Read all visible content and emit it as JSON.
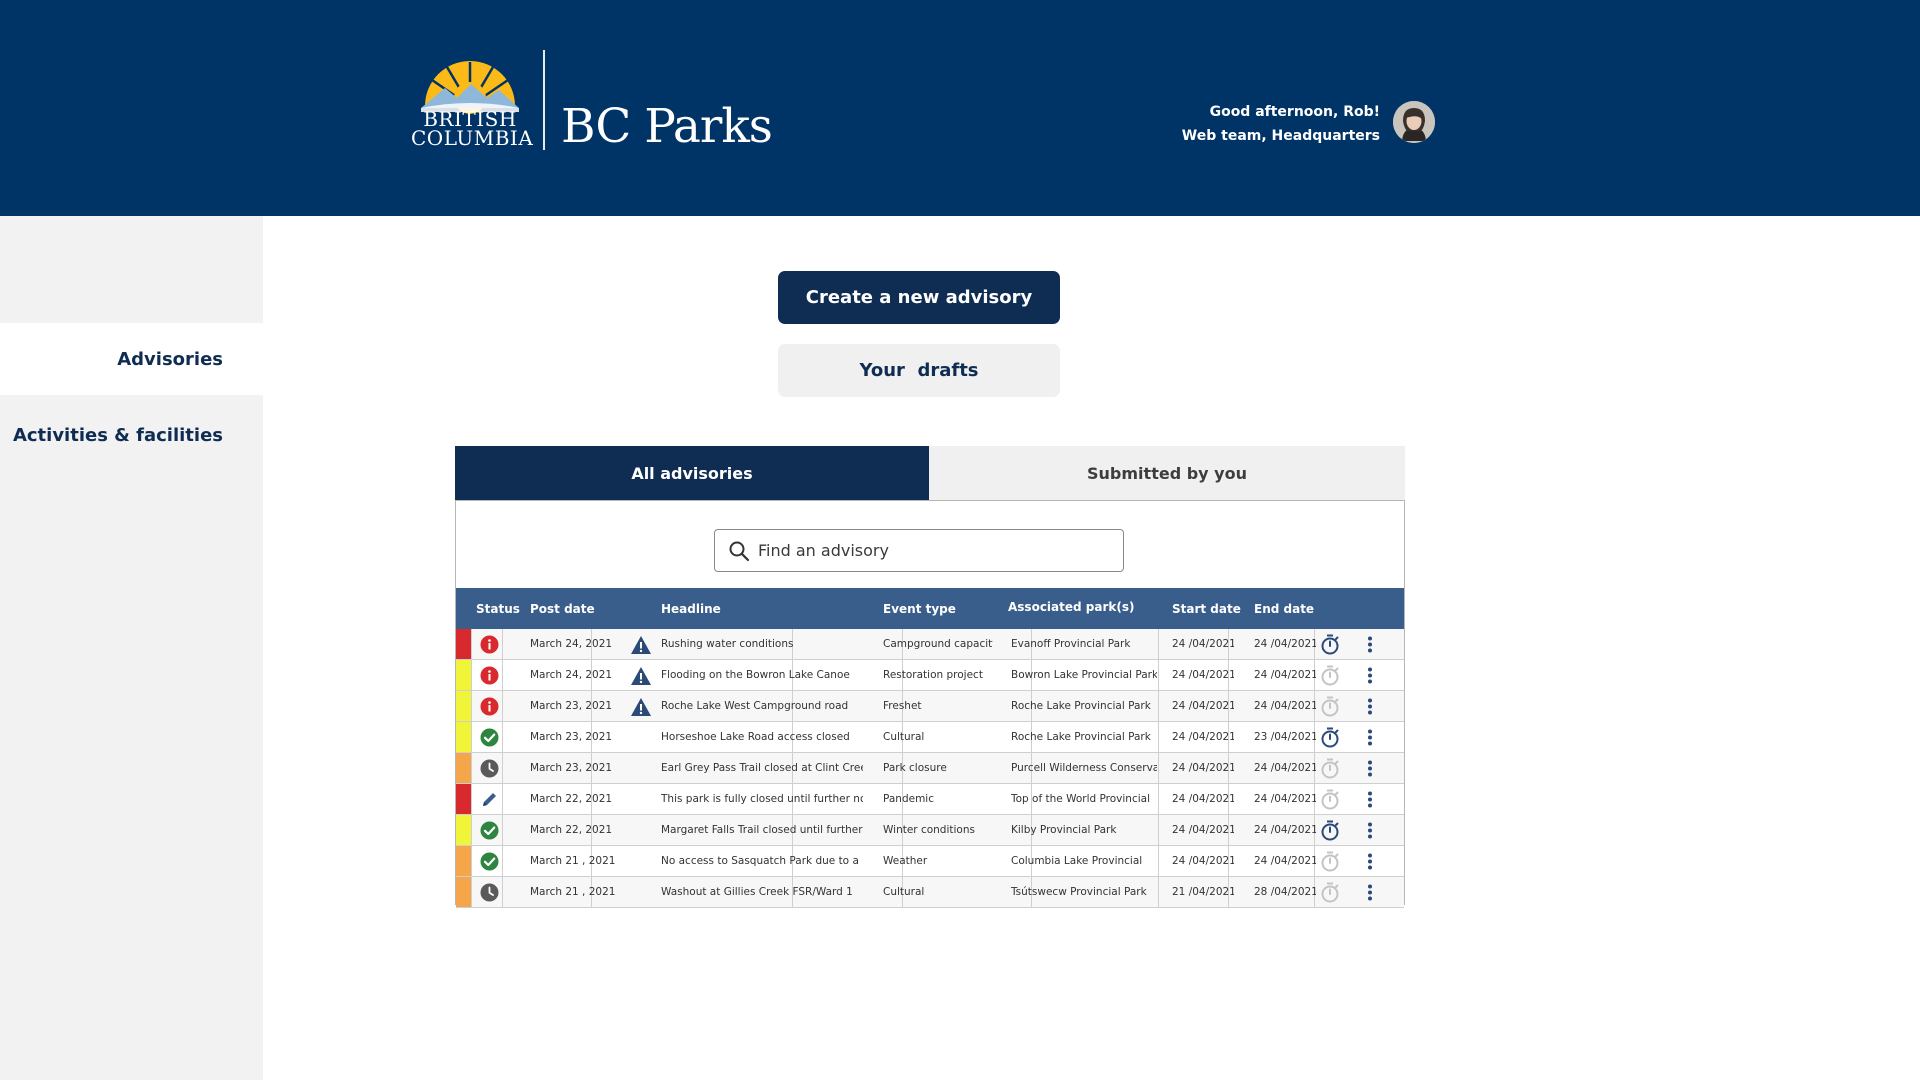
{
  "header": {
    "logo_left_lines": [
      "BRITISH",
      "COLUMBIA"
    ],
    "logo_right": "BC Parks",
    "greeting": "Good afternoon, Rob!",
    "team": "Web team, Headquarters"
  },
  "sidebar": {
    "items": [
      {
        "label": "Advisories",
        "active": true
      },
      {
        "label": "Activities & facilities",
        "active": false
      }
    ]
  },
  "actions": {
    "create_label": "Create a new advisory",
    "drafts_label": "Your  drafts"
  },
  "tabs": [
    {
      "label": "All advisories",
      "active": true
    },
    {
      "label": "Submitted by you",
      "active": false
    }
  ],
  "search": {
    "placeholder": "Find an advisory"
  },
  "table": {
    "columns": [
      "Status",
      "Post date",
      "Headline",
      "Event type",
      "Associated park(s)",
      "Start date",
      "End date"
    ],
    "rows": [
      {
        "urgency": "red",
        "status": "alert",
        "post_date": "March 24, 2021",
        "warning": true,
        "headline": "Rushing water conditions",
        "event_type": "Campground capacity",
        "park": "Evanoff Provincial Park",
        "start": "24 /04/2021",
        "end": "24 /04/2021",
        "timer": "active"
      },
      {
        "urgency": "yellow",
        "status": "alert",
        "post_date": "March 24, 2021",
        "warning": true,
        "headline": "Flooding on the Bowron Lake Canoe",
        "event_type": "Restoration project",
        "park": "Bowron Lake Provincial Park",
        "start": "24 /04/2021",
        "end": "24 /04/2021",
        "timer": "inactive"
      },
      {
        "urgency": "yellow",
        "status": "alert",
        "post_date": "March 23, 2021",
        "warning": true,
        "headline": "Roche Lake West Campground road",
        "event_type": "Freshet",
        "park": "Roche Lake Provincial Park",
        "start": "24 /04/2021",
        "end": "24 /04/2021",
        "timer": "inactive"
      },
      {
        "urgency": "yellow",
        "status": "published",
        "post_date": "March 23, 2021",
        "warning": false,
        "headline": "Horseshoe Lake Road access closed",
        "event_type": "Cultural",
        "park": "Roche Lake Provincial Park",
        "start": "24 /04/2021",
        "end": "23 /04/2021",
        "timer": "active"
      },
      {
        "urgency": "orange",
        "status": "scheduled",
        "post_date": "March 23, 2021",
        "warning": false,
        "headline": "Earl Grey Pass Trail closed at Clint Creek",
        "event_type": "Park closure",
        "park": "Purcell Wilderness Conserva",
        "start": "24 /04/2021",
        "end": "24 /04/2021",
        "timer": "inactive"
      },
      {
        "urgency": "red",
        "status": "draft",
        "post_date": "March 22, 2021",
        "warning": false,
        "headline": "This park is fully closed until further noti",
        "event_type": "Pandemic",
        "park": "Top of the World Provincial",
        "start": "24 /04/2021",
        "end": "24 /04/2021",
        "timer": "inactive"
      },
      {
        "urgency": "yellow",
        "status": "published",
        "post_date": "March 22, 2021",
        "warning": false,
        "headline": "Margaret Falls Trail closed until further",
        "event_type": "Winter conditions",
        "park": "Kilby Provincial Park",
        "start": "24 /04/2021",
        "end": "24 /04/2021",
        "timer": "active"
      },
      {
        "urgency": "orange",
        "status": "published",
        "post_date": "March 21 , 2021",
        "warning": false,
        "headline": "No access to Sasquatch Park due to a",
        "event_type": "Weather",
        "park": "Columbia Lake Provincial",
        "start": "24 /04/2021",
        "end": "24 /04/2021",
        "timer": "inactive"
      },
      {
        "urgency": "orange",
        "status": "scheduled",
        "post_date": "March 21 , 2021",
        "warning": false,
        "headline": "Washout at Gillies Creek FSR/Ward 1",
        "event_type": "Cultural",
        "park": "Tsútswecw Provincial Park",
        "start": "21 /04/2021",
        "end": "28 /04/2021",
        "timer": "inactive"
      }
    ]
  },
  "colors": {
    "brand_navy": "#003366",
    "primary_button": "#0f2d52",
    "table_header": "#3a5e8c",
    "urgency_red": "#d8292f",
    "urgency_yellow": "#f0f53a",
    "urgency_orange": "#f5a54a",
    "status_alert": "#d8292f",
    "status_published": "#2e8540",
    "status_scheduled": "#5a5a5a",
    "status_draft": "#3a5e8c",
    "logo_sun": "#fcba19"
  },
  "icons": {
    "search": "search-icon",
    "alert": "alert-circle-icon",
    "published": "check-circle-icon",
    "scheduled": "clock-icon",
    "draft": "pencil-icon",
    "warning": "warning-triangle-icon",
    "timer": "timer-icon",
    "menu": "kebab-menu-icon"
  }
}
